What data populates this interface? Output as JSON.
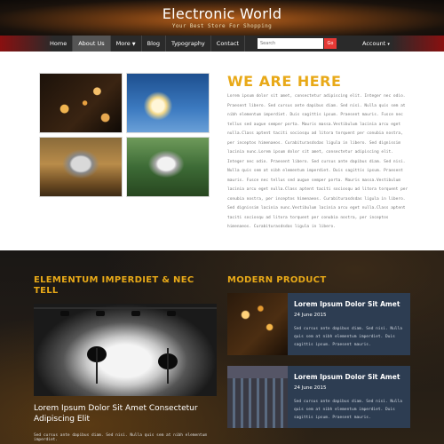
{
  "header": {
    "title": "Electronic World",
    "tagline": "Your Best Store For Shopping"
  },
  "nav": {
    "items": [
      "Home",
      "About Us",
      "More",
      "Blog",
      "Typography",
      "Contact"
    ],
    "search_placeholder": "Search",
    "search_button": "Go",
    "account": "Account"
  },
  "about": {
    "heading": "WE ARE HERE",
    "text": "Lorem ipsum dolor sit amet, consectetur adipiscing elit. Integer nec odio. Praesent libero. Sed cursus ante dapibus diam. Sed nisi. Nulla quis sem at nibh elementum imperdiet. Duis sagittis ipsum. Praesent mauris. Fusce nec tellus sed augue semper porta. Mauris massa.Vestibulum lacinia arcu eget nulla.Class aptent taciti sociosqu ad litora torquent per conubia nostra, per inceptos himenaeos. Curabiturasdsdas ligula in libero. Sed dignissim lacinia nunc.Lorem ipsum dolor sit amet, consectetur adipiscing elit. Integer nec odio. Praesent libero. Sed cursus ante dapibus diam. Sed nisi. Nulla quis sem at nibh elementum imperdiet. Duis sagittis ipsum. Praesent mauris. Fusce nec tellus sed augue semper porta. Mauris massa.Vestibulum lacinia arcu eget nulla.Class aptent taciti sociosqu ad litora torquent per conubia nostra, per inceptos himenaeos. Curabiturasdsdas ligula in libero. Sed dignissim lacinia nunc.Vestibulum lacinia arcu eget nulla.Class aptent taciti sociosqu ad litora torquent per conubia nostra, per inceptos himenaeos. Curabiturasdsdas ligula in libero."
  },
  "feature": {
    "heading": "ELEMENTUM IMPERDIET & NEC TELL",
    "caption": "Lorem Ipsum Dolor Sit Amet Consectetur Adipiscing Elit",
    "small": "Sed cursus ante dapibus diam. Sed nisi. Nulla quis sem at nibh elementum imperdiet."
  },
  "products": {
    "heading": "MODERN PRODUCT",
    "items": [
      {
        "title": "Lorem Ipsum Dolor Sit Amet",
        "date": "24 June 2015",
        "desc": "Sed cursus ante dapibus diam. Sed nisi. Nulla quis sem at nibh elementum imperdiet. Duis sagittis ipsum. Praesent mauris."
      },
      {
        "title": "Lorem Ipsum Dolor Sit Amet",
        "date": "24 June 2015",
        "desc": "Sed cursus ante dapibus diam. Sed nisi. Nulla quis sem at nibh elementum imperdiet. Duis sagittis ipsum. Praesent mauris."
      }
    ]
  },
  "colors": {
    "accent": "#e8a918",
    "nav_bg": "#2a2a2a",
    "nav_edge": "#8a1010",
    "search_button": "#e53935",
    "product_card": "#2d3d52"
  }
}
